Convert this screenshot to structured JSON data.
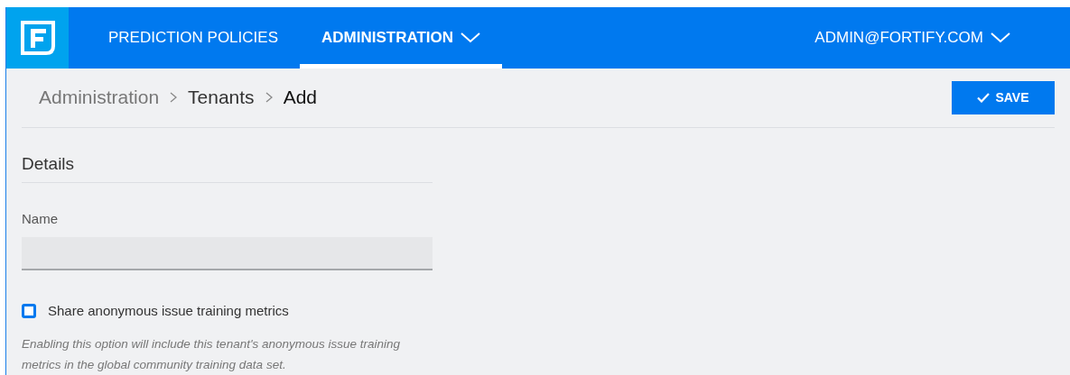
{
  "nav": {
    "items": [
      {
        "label": "PREDICTION POLICIES",
        "selected": false,
        "dropdown": false
      },
      {
        "label": "ADMINISTRATION",
        "selected": true,
        "dropdown": true
      }
    ],
    "user": "ADMIN@FORTIFY.COM"
  },
  "breadcrumb": [
    "Administration",
    "Tenants",
    "Add"
  ],
  "save_button": "SAVE",
  "section_title": "Details",
  "name_field": {
    "label": "Name"
  },
  "checkbox": {
    "label": "Share anonymous issue training metrics",
    "checked": false
  },
  "help_text": "Enabling this option will include this tenant's anonymous issue training metrics in the global community training data set."
}
